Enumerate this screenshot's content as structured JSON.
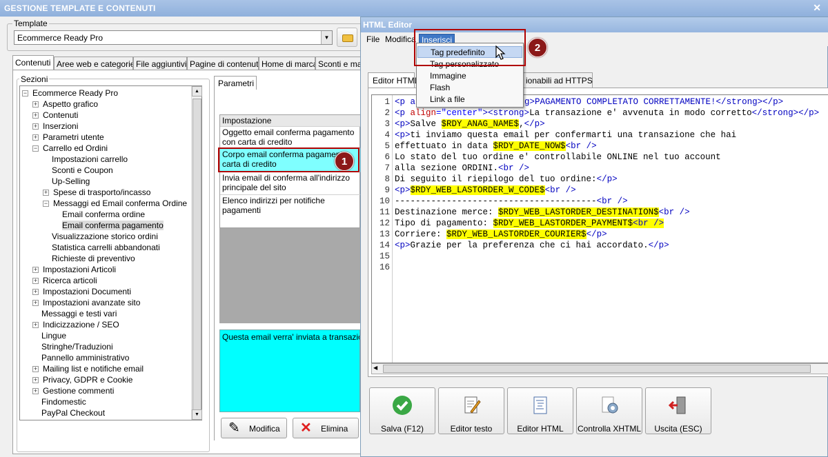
{
  "main_window": {
    "title": "GESTIONE TEMPLATE E CONTENUTI",
    "close": "✕"
  },
  "template": {
    "legend": "Template",
    "selected": "Ecommerce Ready Pro",
    "arrow": "▼"
  },
  "tabs": [
    "Contenuti",
    "Aree web e categorie",
    "File aggiuntivi",
    "Pagine di contenuti",
    "Home di marca",
    "Sconti e ma"
  ],
  "sezioni": {
    "legend": "Sezioni",
    "items": [
      {
        "label": "Ecommerce Ready Pro",
        "exp": "−"
      },
      {
        "label": "Aspetto grafico",
        "exp": "+"
      },
      {
        "label": "Contenuti",
        "exp": "+"
      },
      {
        "label": "Inserzioni",
        "exp": "+"
      },
      {
        "label": "Parametri utente",
        "exp": "+"
      },
      {
        "label": "Carrello ed Ordini",
        "exp": "−"
      },
      {
        "label": "Impostazioni carrello",
        "exp": ""
      },
      {
        "label": "Sconti e Coupon",
        "exp": ""
      },
      {
        "label": "Up-Selling",
        "exp": ""
      },
      {
        "label": "Spese di trasporto/incasso",
        "exp": "+"
      },
      {
        "label": "Messaggi ed Email conferma Ordine",
        "exp": "−"
      },
      {
        "label": "Email conferma ordine",
        "exp": ""
      },
      {
        "label": "Email conferma pagamento",
        "exp": ""
      },
      {
        "label": "Visualizzazione storico ordini",
        "exp": ""
      },
      {
        "label": "Statistica carrelli abbandonati",
        "exp": ""
      },
      {
        "label": "Richieste di preventivo",
        "exp": ""
      },
      {
        "label": "Impostazioni Articoli",
        "exp": "+"
      },
      {
        "label": "Ricerca articoli",
        "exp": "+"
      },
      {
        "label": "Impostazioni Documenti",
        "exp": "+"
      },
      {
        "label": "Impostazioni avanzate sito",
        "exp": "+"
      },
      {
        "label": "Messaggi e testi vari",
        "exp": ""
      },
      {
        "label": "Indicizzazione / SEO",
        "exp": "+"
      },
      {
        "label": "Lingue",
        "exp": ""
      },
      {
        "label": "Stringhe/Traduzioni",
        "exp": ""
      },
      {
        "label": "Pannello amministrativo",
        "exp": ""
      },
      {
        "label": "Mailing list e notifiche email",
        "exp": "+"
      },
      {
        "label": "Privacy, GDPR e Cookie",
        "exp": "+"
      },
      {
        "label": "Gestione commenti",
        "exp": "+"
      },
      {
        "label": "Findomestic",
        "exp": ""
      },
      {
        "label": "PayPal Checkout",
        "exp": ""
      }
    ]
  },
  "parametri": {
    "tab": "Parametri",
    "header": "Impostazione",
    "rows": [
      "Oggetto email conferma pagamento con carta di credito",
      "Corpo email conferma pagamento carta di credito",
      "Invia email di conferma all'indirizzo principale del sito",
      "Elenco indirizzi per notifiche pagamenti"
    ],
    "description": "Questa email verra' inviata a transazione a",
    "buttons": {
      "modifica": "Modifica",
      "elimina": "Elimina"
    }
  },
  "editor": {
    "title": "HTML Editor",
    "menu": [
      "File",
      "Modifica",
      "Inserisci"
    ],
    "dropdown": [
      "Tag predefinito",
      "Tag personalizzato",
      "Immagine",
      "Flash",
      "Link a file"
    ],
    "tabs": [
      "Editor HTML",
      "ionabili ad HTTPS"
    ],
    "line_numbers": [
      "1",
      "2",
      "3",
      "4",
      "5",
      "6",
      "7",
      "8",
      "9",
      "10",
      "11",
      "12",
      "13",
      "14",
      "15",
      "16"
    ],
    "code": {
      "l1": {
        "a": "<p a",
        "b": "g>PAGAMENTO COMPLETATO CORRETTAMENTE!</strong></p>"
      },
      "l2": {
        "a": "<p ",
        "b": "align",
        "c": "=\"center\"",
        "d": "><strong>",
        "e": "La transazione e' avvenuta in modo corretto",
        "f": "</strong></p>"
      },
      "l3": {
        "a": "<p>",
        "b": "Salve ",
        "c": "$RDY_ANAG_NAME$",
        "d": ",",
        "e": "</p>"
      },
      "l4": {
        "a": "<p>",
        "b": "ti inviamo questa email per confermarti una transazione che hai"
      },
      "l5": {
        "a": "effettuato in data ",
        "b": "$RDY_DATE_NOW$",
        "c": "<br />"
      },
      "l6": {
        "a": "Lo stato del tuo ordine e' controllabile ONLINE nel tuo account"
      },
      "l7": {
        "a": "alla sezione ORDINI.",
        "b": "<br />"
      },
      "l8": {
        "a": "Di seguito il riepilogo del tuo ordine:",
        "b": "</p>"
      },
      "l9": {
        "a": "<p>",
        "b": "$RDY_WEB_LASTORDER_W_CODE$",
        "c": "<br />"
      },
      "l10": {
        "a": "---------------------------------------",
        "b": "<br />"
      },
      "l11": {
        "a": "Destinazione merce: ",
        "b": "$RDY_WEB_LASTORDER_DESTINATION$",
        "c": "<br />"
      },
      "l12": {
        "a": "Tipo di pagamento: ",
        "b": "$RDY_WEB_LASTORDER_PAYMENT$",
        "c": "<br />"
      },
      "l13": {
        "a": "Corriere: ",
        "b": "$RDY_WEB_LASTORDER_COURIER$",
        "c": "</p>"
      },
      "l14": {
        "a": "<p>",
        "b": "Grazie per la preferenza che ci hai accordato.",
        "c": "</p>"
      }
    },
    "buttons": [
      "Salva (F12)",
      "Editor testo",
      "Editor HTML",
      "Controlla XHTML",
      "Uscita (ESC)"
    ]
  },
  "callouts": [
    "1",
    "2"
  ]
}
